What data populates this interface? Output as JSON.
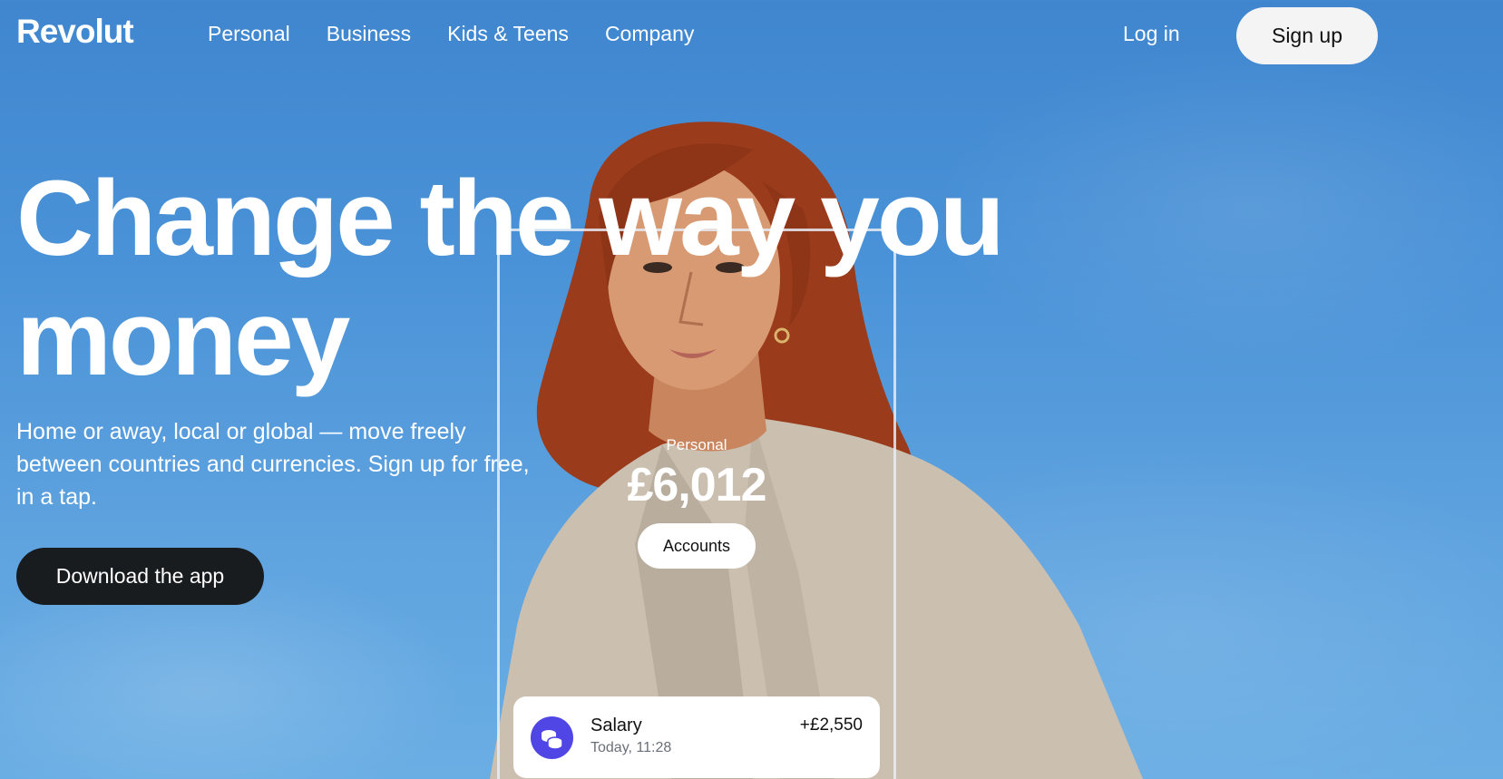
{
  "brand": {
    "name": "Revolut"
  },
  "nav": {
    "links": [
      "Personal",
      "Business",
      "Kids & Teens",
      "Company"
    ],
    "login": "Log in",
    "signup": "Sign up"
  },
  "hero": {
    "title": "Change the way you money",
    "subtitle": "Home or away, local or global — move freely between countries and currencies. Sign up for free, in a tap.",
    "cta": "Download the app"
  },
  "phone": {
    "account_label": "Personal",
    "balance": "£6,012",
    "accounts_button": "Accounts",
    "transaction": {
      "title": "Salary",
      "time": "Today, 11:28",
      "amount": "+£2,550",
      "icon": "coins-icon"
    }
  },
  "colors": {
    "sky": "#4b93d8",
    "dark_button": "#191c1f",
    "light_button": "#f4f4f5",
    "transaction_icon": "#5046e5"
  }
}
